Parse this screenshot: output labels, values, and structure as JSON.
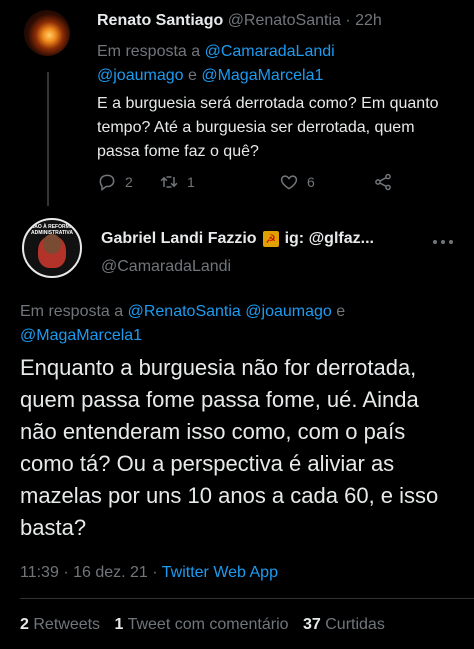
{
  "reply": {
    "name": "Renato Santiago",
    "handle": "@RenatoSantia",
    "dot": "·",
    "time": "22h",
    "replying_prefix": "Em resposta a",
    "mention1": "@CamaradaLandi",
    "mention2": "@joaumago",
    "and": "e",
    "mention3": "@MagaMarcela1",
    "text": "E a burguesia será derrotada como? Em quanto tempo? Até a burguesia ser derrotada, quem passa fome faz o quê?",
    "reply_count": "2",
    "retweet_count": "1",
    "like_count": "6"
  },
  "main": {
    "name": "Gabriel Landi Fazzio",
    "flag_emoji": "☭",
    "name_suffix": "ig: @glfaz...",
    "handle": "@CamaradaLandi",
    "avatar_text": "NÃO À REFORMA ADMINISTRATIVA",
    "replying_prefix": "Em resposta a",
    "mention1": "@RenatoSantia",
    "mention2": "@joaumago",
    "and": "e",
    "mention3": "@MagaMarcela1",
    "text": "Enquanto a burguesia não for derrotada, quem passa fome passa fome, ué. Ainda não entenderam isso como, com o país como tá? Ou a perspectiva é aliviar as mazelas por uns 10 anos a cada 60, e isso basta?",
    "time": "11:39",
    "dot": "·",
    "date": "16 dez. 21",
    "dot2": "·",
    "source": "Twitter Web App",
    "retweets_count": "2",
    "retweets_label": "Retweets",
    "quotes_count": "1",
    "quotes_label": "Tweet com comentário",
    "likes_count": "37",
    "likes_label": "Curtidas"
  }
}
